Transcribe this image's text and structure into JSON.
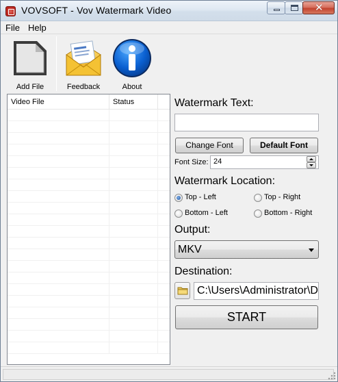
{
  "window": {
    "title": "VOVSOFT - Vov Watermark Video",
    "controls": [
      "minimize",
      "maximize",
      "close"
    ]
  },
  "menu": {
    "items": [
      {
        "label": "File"
      },
      {
        "label": "Help"
      }
    ]
  },
  "toolbar": {
    "buttons": [
      {
        "label": "Add File",
        "icon": "document-icon"
      },
      {
        "label": "Feedback",
        "icon": "envelope-icon"
      },
      {
        "label": "About",
        "icon": "info-icon"
      }
    ]
  },
  "file_list": {
    "columns": [
      "Video File",
      "Status"
    ],
    "rows": []
  },
  "watermark": {
    "text_label": "Watermark Text:",
    "text_value": "",
    "change_font_label": "Change Font",
    "default_font_label": "Default Font",
    "font_size_label": "Font Size:",
    "font_size_value": "24"
  },
  "location": {
    "label": "Watermark Location:",
    "options": [
      {
        "label": "Top - Left",
        "checked": true
      },
      {
        "label": "Top - Right",
        "checked": false
      },
      {
        "label": "Bottom - Left",
        "checked": false
      },
      {
        "label": "Bottom - Right",
        "checked": false
      }
    ]
  },
  "output": {
    "label": "Output:",
    "selected": "MKV"
  },
  "destination": {
    "label": "Destination:",
    "path": "C:\\Users\\Administrator\\D"
  },
  "start_label": "START"
}
